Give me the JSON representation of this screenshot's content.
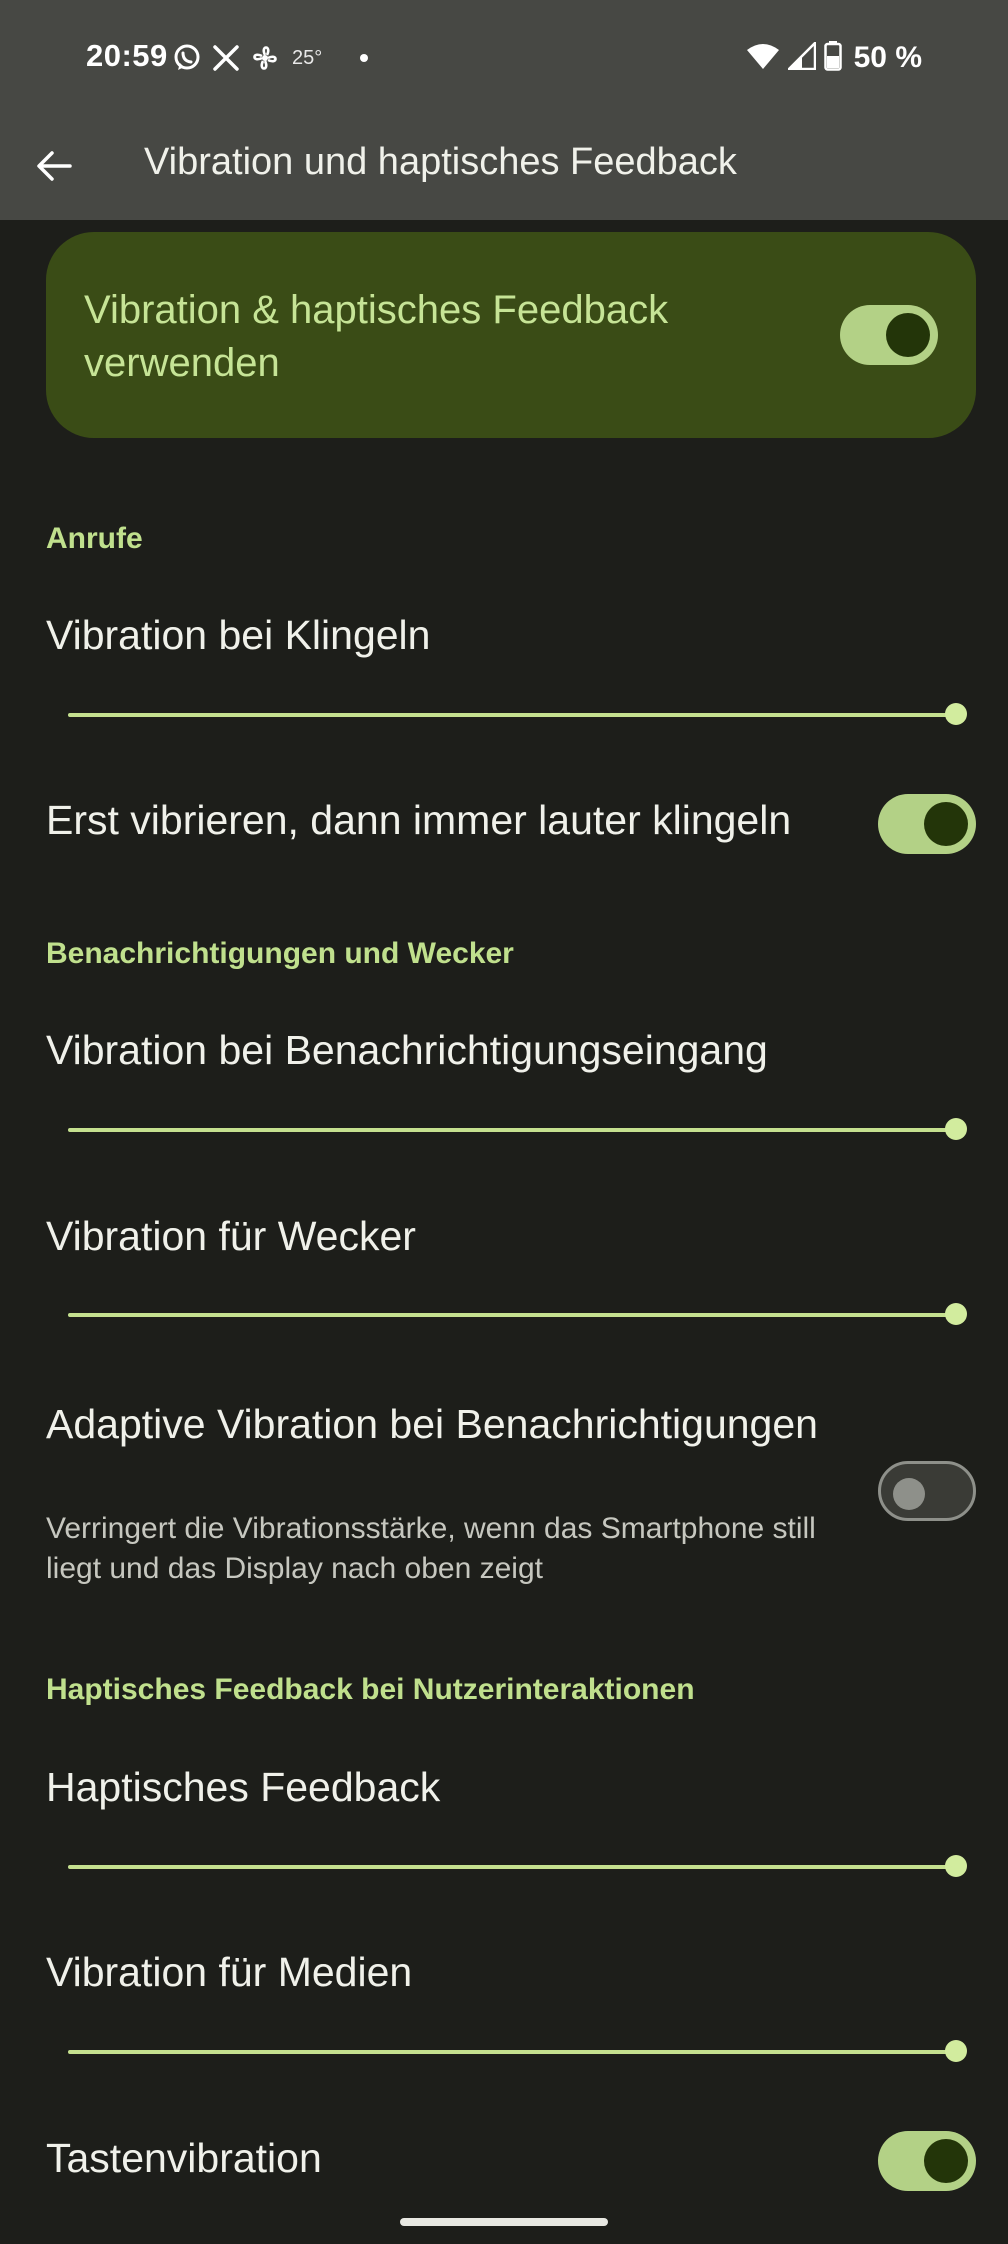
{
  "status_bar": {
    "time": "20:59",
    "notification_icons": [
      "whatsapp-icon",
      "x-icon",
      "fan-icon"
    ],
    "temperature": "25°",
    "battery": "50 %"
  },
  "app_bar": {
    "title": "Vibration und haptisches Feedback"
  },
  "main_toggle": {
    "label": "Vibration & haptisches Feedback verwenden",
    "on": true
  },
  "sections": {
    "calls": {
      "header": "Anrufe",
      "ring_vibration": {
        "label": "Vibration bei Klingeln",
        "level": 1.0
      },
      "vibrate_then_ring": {
        "label": "Erst vibrieren, dann immer lauter klingeln",
        "on": true
      }
    },
    "notifications": {
      "header": "Benachrichtigungen und Wecker",
      "notification_vibration": {
        "label": "Vibration bei Benachrichtigungseingang",
        "level": 1.0
      },
      "alarm_vibration": {
        "label": "Vibration für Wecker",
        "level": 1.0
      },
      "adaptive": {
        "label": "Adaptive Vibration bei Benachrichtigungen",
        "description": "Verringert die Vibrationsstärke, wenn das Smartphone still liegt und das Display nach oben zeigt",
        "on": false
      }
    },
    "haptics": {
      "header": "Haptisches Feedback bei Nutzerinteraktionen",
      "haptic_feedback": {
        "label": "Haptisches Feedback",
        "level": 1.0
      },
      "media_vibration": {
        "label": "Vibration für Medien",
        "level": 1.0
      },
      "key_vibration": {
        "label": "Tastenvibration",
        "on": true
      }
    }
  },
  "colors": {
    "background": "#1d1e1a",
    "app_bar": "#474844",
    "accent": "#c0e08d",
    "card": "#3a4c16"
  }
}
